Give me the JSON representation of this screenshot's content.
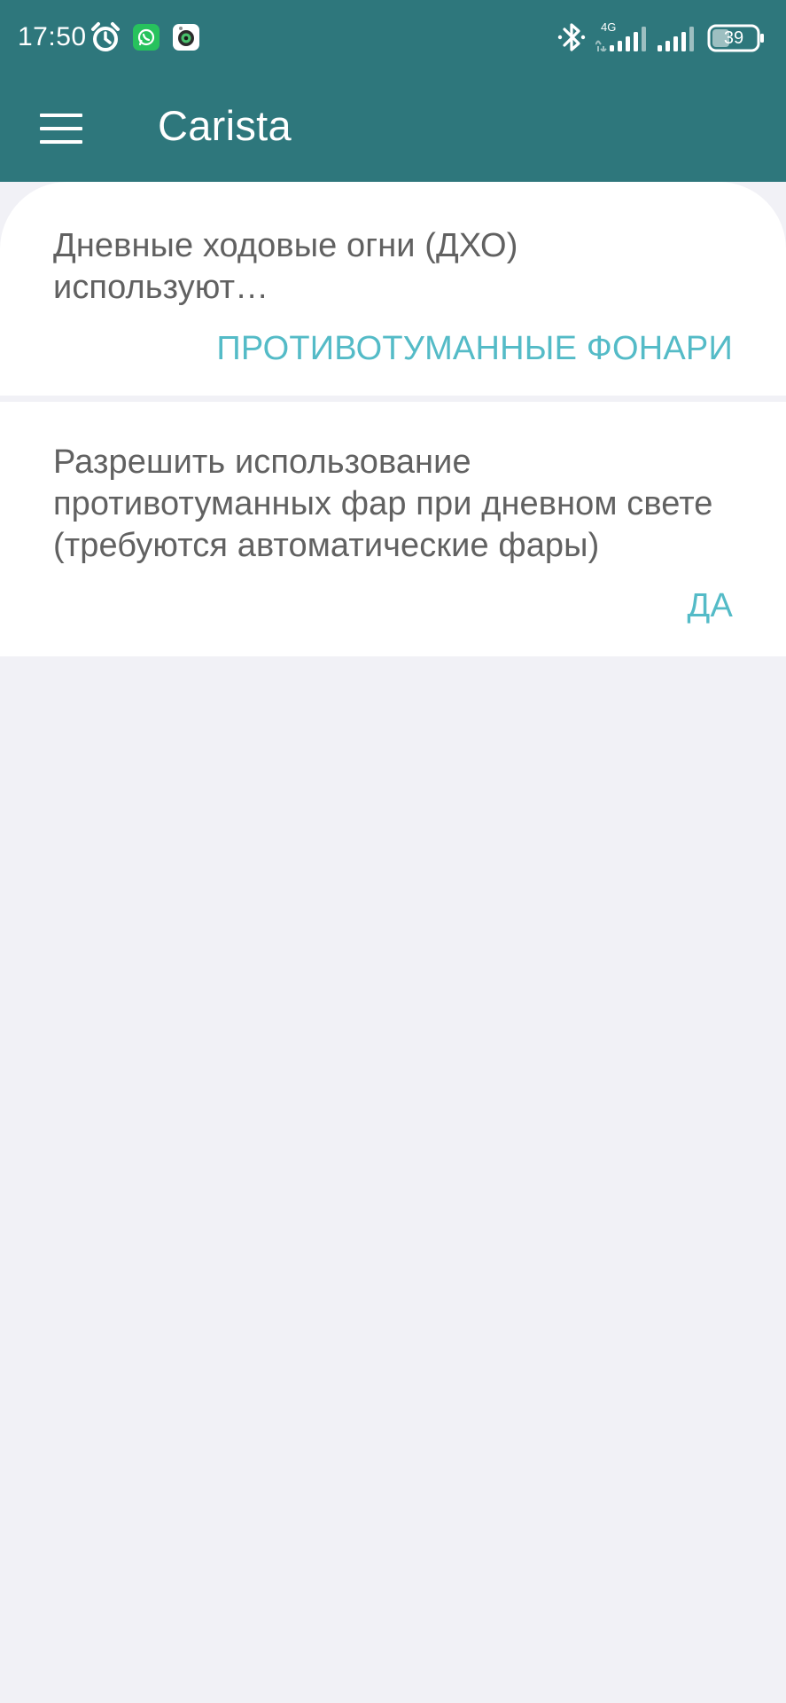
{
  "status_bar": {
    "time": "17:50",
    "network": "4G",
    "battery": "39",
    "icons": [
      "alarm-icon",
      "whatsapp-icon",
      "camera-app-icon",
      "bluetooth-icon",
      "signal-4g-icon",
      "signal-icon",
      "battery-icon"
    ]
  },
  "toolbar": {
    "menu_icon": "hamburger-menu-icon",
    "title": "Carista"
  },
  "settings": [
    {
      "title": "Дневные ходовые огни (ДХО) используют…",
      "value": "ПРОТИВОТУМАННЫЕ ФОНАРИ"
    },
    {
      "title": "Разрешить использование противотуманных фар при дневном свете (требуются автоматические фары)",
      "value": "ДА"
    }
  ],
  "colors": {
    "header": "#2E777C",
    "accent": "#54BBC7",
    "card": "#FFFFFF",
    "background": "#F1F1F6",
    "text": "#616161"
  }
}
